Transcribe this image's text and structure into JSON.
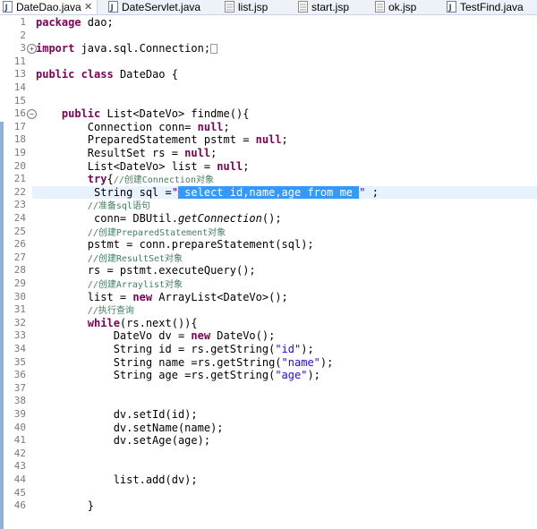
{
  "tabs": [
    {
      "label": "DateDao.java",
      "active": true,
      "closable": true,
      "icon": "java-file-icon"
    },
    {
      "label": "DateServlet.java",
      "active": false,
      "icon": "java-file-icon"
    },
    {
      "label": "list.jsp",
      "active": false,
      "icon": "jsp-file-icon"
    },
    {
      "label": "start.jsp",
      "active": false,
      "icon": "jsp-file-icon"
    },
    {
      "label": "ok.jsp",
      "active": false,
      "icon": "jsp-file-icon"
    },
    {
      "label": "TestFind.java",
      "active": false,
      "icon": "java-file-icon"
    }
  ],
  "editor": {
    "current_line": 22,
    "lines": [
      {
        "n": "1",
        "text": "package dao;"
      },
      {
        "n": "2",
        "text": ""
      },
      {
        "n": "3",
        "text": "import java.sql.Connection;",
        "fold": "+"
      },
      {
        "n": "11",
        "text": ""
      },
      {
        "n": "13",
        "text": "public class DateDao {"
      },
      {
        "n": "14",
        "text": ""
      },
      {
        "n": "15",
        "text": ""
      },
      {
        "n": "16",
        "text": "    public List<DateVo> findme(){",
        "fold": "-"
      },
      {
        "n": "17",
        "text": "        Connection conn= null;"
      },
      {
        "n": "18",
        "text": "        PreparedStatement pstmt = null;"
      },
      {
        "n": "19",
        "text": "        ResultSet rs = null;"
      },
      {
        "n": "20",
        "text": "        List<DateVo> list = null;"
      },
      {
        "n": "21",
        "text": "        try{//创建Connection对象"
      },
      {
        "n": "22",
        "text": "         String sql =\" select id,name,age from me \" ;"
      },
      {
        "n": "23",
        "text": "        //准备sql语句"
      },
      {
        "n": "24",
        "text": "         conn= DBUtil.getConnection();"
      },
      {
        "n": "25",
        "text": "        //创建PreparedStatement对象"
      },
      {
        "n": "26",
        "text": "        pstmt = conn.prepareStatement(sql);"
      },
      {
        "n": "27",
        "text": "        //创建ResultSet对象"
      },
      {
        "n": "28",
        "text": "        rs = pstmt.executeQuery();"
      },
      {
        "n": "29",
        "text": "        //创建Arraylist对象"
      },
      {
        "n": "30",
        "text": "        list = new ArrayList<DateVo>();"
      },
      {
        "n": "31",
        "text": "        //执行查询"
      },
      {
        "n": "32",
        "text": "        while(rs.next()){"
      },
      {
        "n": "33",
        "text": "            DateVo dv = new DateVo();"
      },
      {
        "n": "34",
        "text": "            String id = rs.getString(\"id\");"
      },
      {
        "n": "35",
        "text": "            String name =rs.getString(\"name\");"
      },
      {
        "n": "36",
        "text": "            String age =rs.getString(\"age\");"
      },
      {
        "n": "37",
        "text": ""
      },
      {
        "n": "38",
        "text": ""
      },
      {
        "n": "39",
        "text": "            dv.setId(id);"
      },
      {
        "n": "40",
        "text": "            dv.setName(name);"
      },
      {
        "n": "41",
        "text": "            dv.setAge(age);"
      },
      {
        "n": "42",
        "text": ""
      },
      {
        "n": "43",
        "text": ""
      },
      {
        "n": "44",
        "text": "            list.add(dv);"
      },
      {
        "n": "45",
        "text": ""
      },
      {
        "n": "46",
        "text": "        }"
      }
    ]
  },
  "colors": {
    "keyword": "#7f0055",
    "string": "#2a00ff",
    "comment": "#3f7f5f",
    "selection": "#3399ff",
    "current_line": "#e8f2fe"
  }
}
